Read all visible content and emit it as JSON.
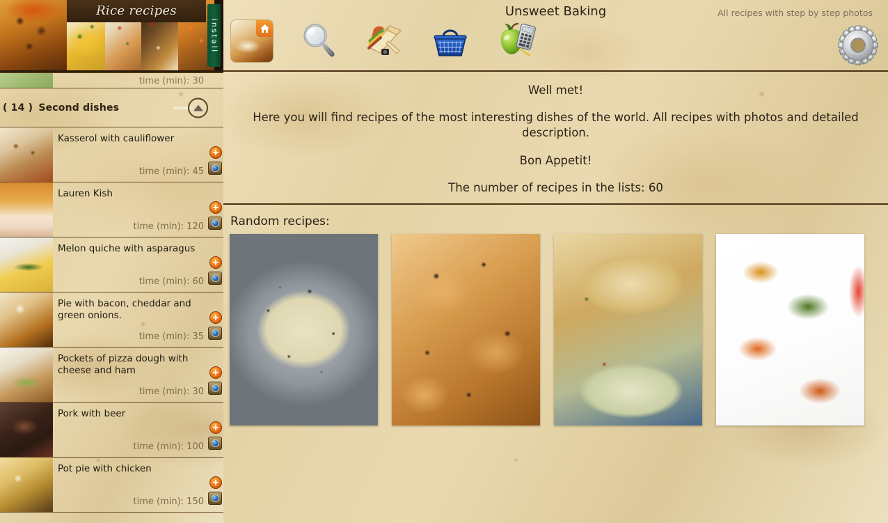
{
  "header": {
    "app_title": "Unsweet Baking",
    "tagline": "All recipes with step by step photos",
    "settings_icon": "gear-icon",
    "toolbar": [
      {
        "name": "home-recipe-button",
        "icon": "home-icon",
        "label": "Home"
      },
      {
        "name": "search-button",
        "icon": "magnifier-icon",
        "label": "Search"
      },
      {
        "name": "recipes-button",
        "icon": "sandwich-recipes-icon",
        "label": "Recipes"
      },
      {
        "name": "shopping-basket-button",
        "icon": "basket-icon",
        "label": "Shopping list"
      },
      {
        "name": "calories-button",
        "icon": "apple-calculator-icon",
        "label": "Calories"
      }
    ]
  },
  "ad": {
    "title": "Rice recipes",
    "install_label": "install",
    "thumbs": [
      "paella-photo",
      "yellow-rice-photo",
      "rice-plate-photo",
      "seafood-salad-photo",
      "shrimp-rice-photo"
    ]
  },
  "welcome": {
    "greeting": "Well met!",
    "paragraph": "Here you will find recipes of the most interesting dishes of the world. All recipes with photos and detailed description.",
    "bon_appetit": "Bon Appetit!",
    "recipe_count_text": "The number of recipes in the lists: 60",
    "recipe_count": 60
  },
  "random": {
    "label": "Random recipes:",
    "photos": [
      {
        "name": "random-recipe-photo-1",
        "alt": "savory rice dish on steel plate"
      },
      {
        "name": "random-recipe-photo-2",
        "alt": "olive biscuits"
      },
      {
        "name": "random-recipe-photo-3",
        "alt": "chicken pot pie with crust"
      },
      {
        "name": "random-recipe-photo-4",
        "alt": "vegetable spiral tartlets"
      }
    ]
  },
  "sidebar": {
    "partial_row": {
      "time_label": "time (min): 30"
    },
    "section": {
      "count_text": "( 14 )",
      "title": "Second dishes",
      "collapse_icon": "chevron-up-icon"
    },
    "time_prefix": "time (min): ",
    "items": [
      {
        "title": "Kasserol with cauliflower",
        "time_text": "time (min): 45",
        "time": 45,
        "thumb": "t-casserole"
      },
      {
        "title": "Lauren Kish",
        "time_text": "time (min): 120",
        "time": 120,
        "thumb": "t-quiche"
      },
      {
        "title": "Melon quiche with asparagus",
        "time_text": "time (min): 60",
        "time": 60,
        "thumb": "t-asparagus"
      },
      {
        "title": "Pie with bacon, cheddar and green onions.",
        "time_text": "time (min): 35",
        "time": 35,
        "thumb": "t-baconpie"
      },
      {
        "title": "Pockets of pizza dough with cheese and ham",
        "time_text": "time (min): 30",
        "time": 30,
        "thumb": "t-pocket"
      },
      {
        "title": "Pork with beer",
        "time_text": "time (min): 100",
        "time": 100,
        "thumb": "t-pork"
      },
      {
        "title": "Pot pie with chicken",
        "time_text": "time (min): 150",
        "time": 150,
        "thumb": "t-potpie"
      }
    ],
    "badges": {
      "add_label": "+",
      "photo_icon": "camera-icon"
    }
  },
  "colors": {
    "parchment": "#e9d9ae",
    "divider": "#4b3114",
    "row_divider": "#6b4a22",
    "text": "#2b2317",
    "muted_text": "#7f6c49",
    "ad_bar": "#32200e",
    "install_green": "#11603a",
    "badge_orange": "#f07818"
  }
}
